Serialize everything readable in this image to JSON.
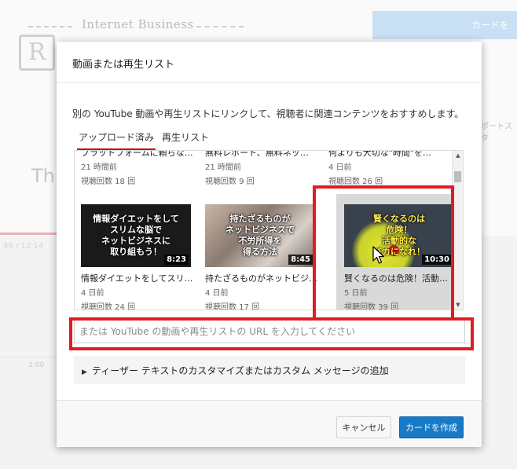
{
  "background": {
    "brand_text": "Internet Business",
    "logo_text": "R",
    "big_text": "Th",
    "corner_button": "カードを",
    "side_text": "ポートスタ",
    "time_text": "46 / 12:14",
    "mark_text": "2:00"
  },
  "dialog": {
    "title": "動画または再生リスト",
    "description": "別の YouTube 動画や再生リストにリンクして、視聴者に関連コンテンツをおすすめします。",
    "tabs": [
      {
        "label": "アップロード済み",
        "active": true
      },
      {
        "label": "再生リスト",
        "active": false
      }
    ],
    "videos_row1": [
      {
        "title": "プラットフォームに頼らな…",
        "age": "21 時間前",
        "views": "視聴回数 18 回"
      },
      {
        "title": "無料レポート、無料ネッ…",
        "age": "21 時間前",
        "views": "視聴回数 9 回"
      },
      {
        "title": "何よりも大切な\"時間\"を…",
        "age": "4 日前",
        "views": "視聴回数 26 回"
      }
    ],
    "videos_row2": [
      {
        "title": "情報ダイエットをしてスリ…",
        "age": "4 日前",
        "views": "視聴回数 24 回",
        "duration": "8:23",
        "thumb_text": "情報ダイエットをして\nスリムな脳で\nネットビジネスに\n取り組もう！"
      },
      {
        "title": "持たざるものがネットビジ…",
        "age": "4 日前",
        "views": "視聴回数 17 回",
        "duration": "8:45",
        "thumb_text": "持たざるものが\nネットビジネスで\n不労所得を\n得る方法"
      },
      {
        "title": "賢くなるのは危険！活動…",
        "age": "5 日前",
        "views": "視聴回数 39 回",
        "duration": "10:30",
        "thumb_text": "賢くなるのは\n危険！\n活動的な\nバカになれ！"
      }
    ],
    "url_placeholder": "または YouTube の動画や再生リストの URL を入力してください",
    "expander_label": "ティーザー テキストのカスタマイズまたはカスタム メッセージの追加",
    "cancel_label": "キャンセル",
    "create_label": "カードを作成"
  },
  "colors": {
    "accent_red": "#e31b23",
    "primary_blue": "#167ac6"
  }
}
